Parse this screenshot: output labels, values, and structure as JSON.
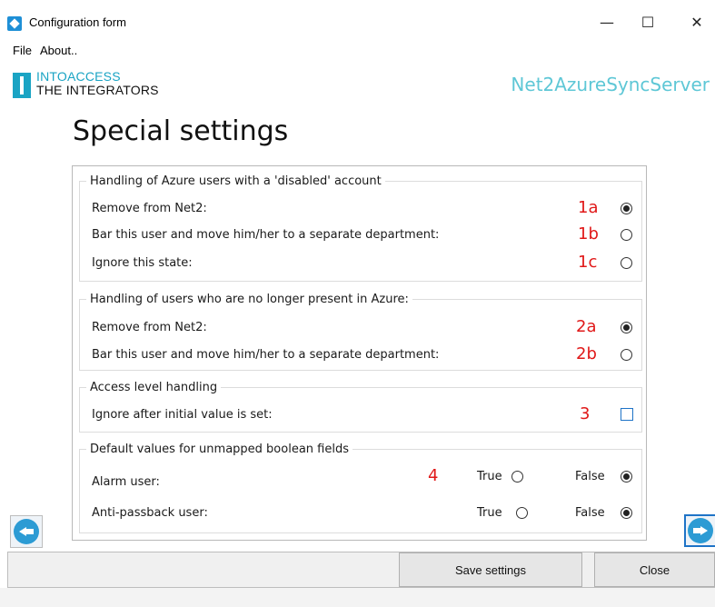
{
  "window": {
    "title": "Configuration form",
    "controls": {
      "minimize": "—",
      "maximize": "☐",
      "close": "✕"
    }
  },
  "menu": {
    "items": [
      "File",
      "About.."
    ]
  },
  "brand": {
    "line1": "INTOACCESS",
    "line2": "THE INTEGRATORS",
    "product": "Net2AzureSyncServer",
    "accent_color": "#1aa4c4",
    "product_color": "#5ec7d6"
  },
  "page": {
    "title": "Special settings"
  },
  "groups": {
    "disabled_account": {
      "legend": "Handling of Azure users with a 'disabled' account",
      "options": [
        {
          "label": "Remove from Net2:",
          "marker": "1a",
          "checked": true
        },
        {
          "label": "Bar this user and move him/her to a separate department:",
          "marker": "1b",
          "checked": false
        },
        {
          "label": "Ignore this state:",
          "marker": "1c",
          "checked": false
        }
      ]
    },
    "not_present": {
      "legend": "Handling of users who are no longer present in Azure:",
      "options": [
        {
          "label": "Remove from Net2:",
          "marker": "2a",
          "checked": true
        },
        {
          "label": "Bar this user and move him/her to a separate department:",
          "marker": "2b",
          "checked": false
        }
      ]
    },
    "access_level": {
      "legend": "Access level handling",
      "label": "Ignore after initial value is set:",
      "marker": "3",
      "checked": false
    },
    "boolean_defaults": {
      "legend": "Default values for unmapped boolean fields",
      "marker": "4",
      "true_label": "True",
      "false_label": "False",
      "rows": [
        {
          "label": "Alarm user:",
          "value": false
        },
        {
          "label": "Anti-passback user:",
          "value": false
        }
      ]
    }
  },
  "buttons": {
    "save": "Save settings",
    "close": "Close"
  },
  "colors": {
    "marker": "#e01818",
    "nav_arrow": "#2c9bd4",
    "focus": "#1e73c7"
  }
}
